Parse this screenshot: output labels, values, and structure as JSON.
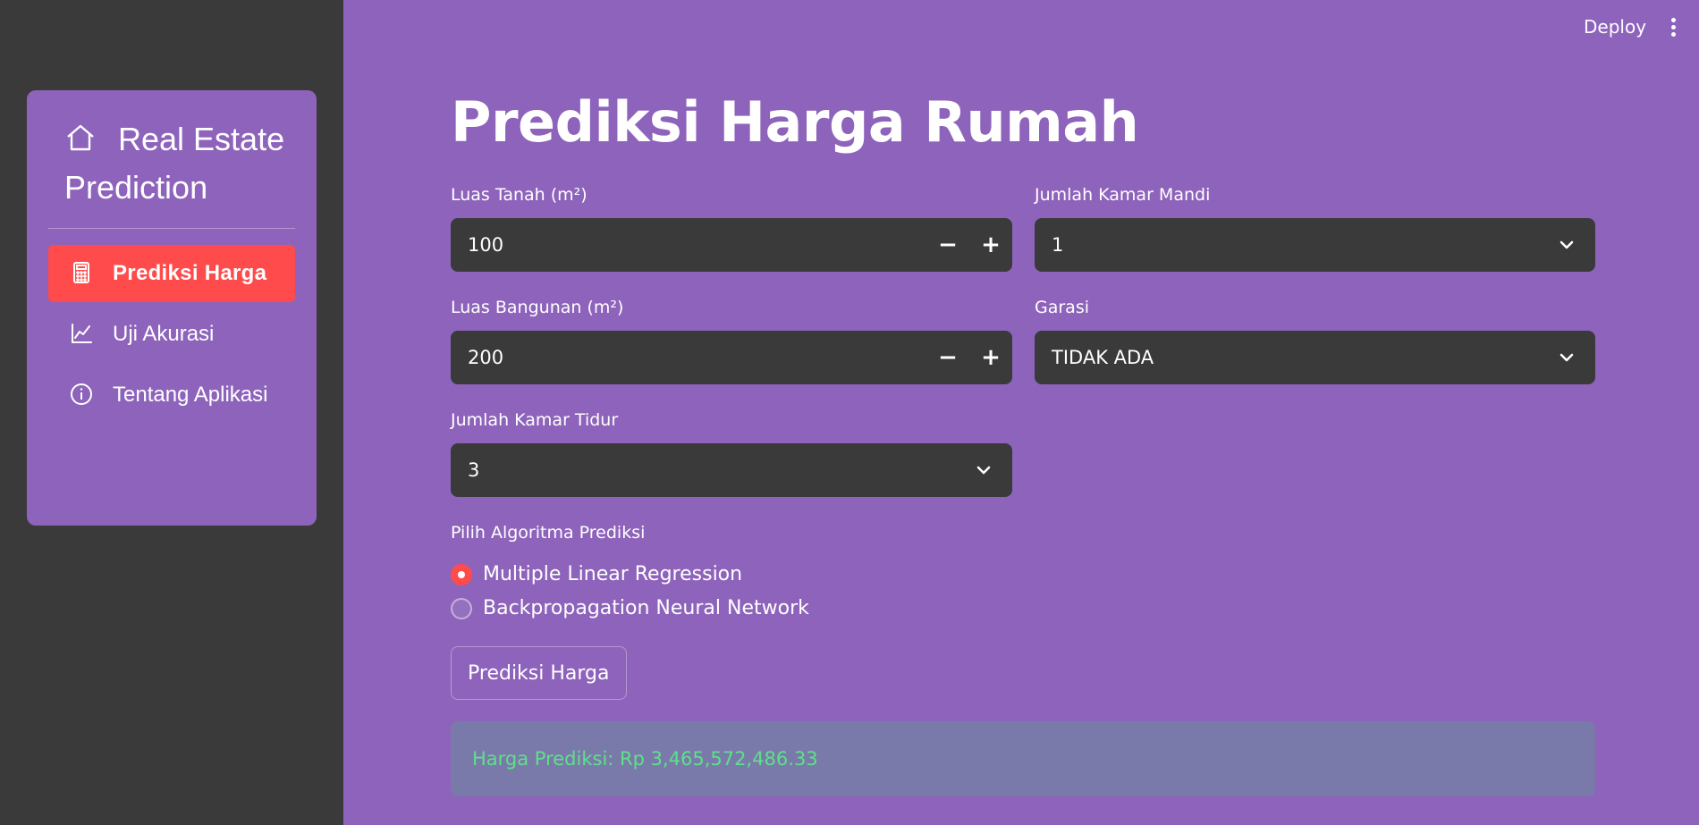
{
  "sidebar": {
    "brand": "Real Estate Prediction",
    "items": [
      {
        "label": "Prediksi Harga",
        "icon": "calculator-icon",
        "active": true
      },
      {
        "label": "Uji Akurasi",
        "icon": "line-chart-icon",
        "active": false
      },
      {
        "label": "Tentang Aplikasi",
        "icon": "info-icon",
        "active": false
      }
    ]
  },
  "header": {
    "deploy_label": "Deploy"
  },
  "main": {
    "title": "Prediksi Harga Rumah",
    "luas_tanah": {
      "label": "Luas Tanah (m²)",
      "value": "100"
    },
    "luas_bangunan": {
      "label": "Luas Bangunan (m²)",
      "value": "200"
    },
    "kamar_tidur": {
      "label": "Jumlah Kamar Tidur",
      "value": "3"
    },
    "kamar_mandi": {
      "label": "Jumlah Kamar Mandi",
      "value": "1"
    },
    "garasi": {
      "label": "Garasi",
      "value": "TIDAK ADA"
    },
    "stepper": {
      "minus": "−",
      "plus": "+"
    },
    "algorithm": {
      "label": "Pilih Algoritma Prediksi",
      "options": [
        "Multiple Linear Regression",
        "Backpropagation Neural Network"
      ],
      "selected": "Multiple Linear Regression"
    },
    "predict_button": "Prediksi Harga",
    "result": "Harga Prediksi: Rp 3,465,572,486.33"
  },
  "colors": {
    "background": "#8e63bb",
    "sidebar": "#3a3a3a",
    "accent": "#ff4b4b",
    "input": "#3a3a3a",
    "success_text": "#5ee08a"
  }
}
